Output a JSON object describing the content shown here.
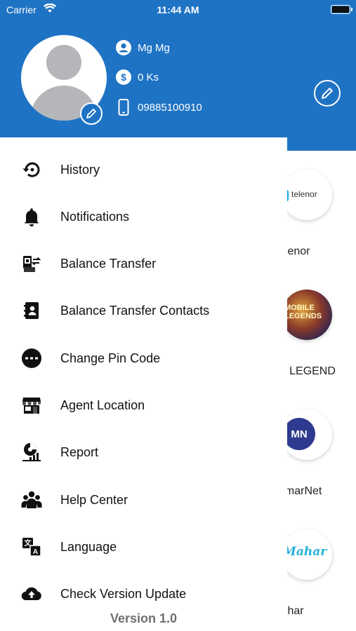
{
  "status_bar": {
    "carrier": "Carrier",
    "time": "11:44 AM"
  },
  "profile": {
    "name": "Mg Mg",
    "balance": "0 Ks",
    "phone": "09885100910"
  },
  "menu": [
    {
      "label": "History",
      "icon": "history-icon"
    },
    {
      "label": "Notifications",
      "icon": "bell-icon"
    },
    {
      "label": "Balance Transfer",
      "icon": "transfer-icon"
    },
    {
      "label": "Balance Transfer Contacts",
      "icon": "contacts-book-icon"
    },
    {
      "label": "Change Pin Code",
      "icon": "pin-code-icon"
    },
    {
      "label": "Agent Location",
      "icon": "store-icon"
    },
    {
      "label": "Report",
      "icon": "report-chart-icon"
    },
    {
      "label": "Help Center",
      "icon": "group-users-icon"
    },
    {
      "label": "Language",
      "icon": "translate-icon"
    },
    {
      "label": "Check Version Update",
      "icon": "cloud-upload-icon"
    }
  ],
  "version": "Version 1.0",
  "background_items": [
    {
      "label": "elenor",
      "logo_text": "telenor"
    },
    {
      "label": "E LEGEND",
      "logo_text": "MOBILE LEGENDS"
    },
    {
      "label": "nmarNet",
      "logo_text": "MN"
    },
    {
      "label": "lahar",
      "logo_text": "Mahar"
    }
  ],
  "colors": {
    "brand_blue": "#1f73c4"
  }
}
